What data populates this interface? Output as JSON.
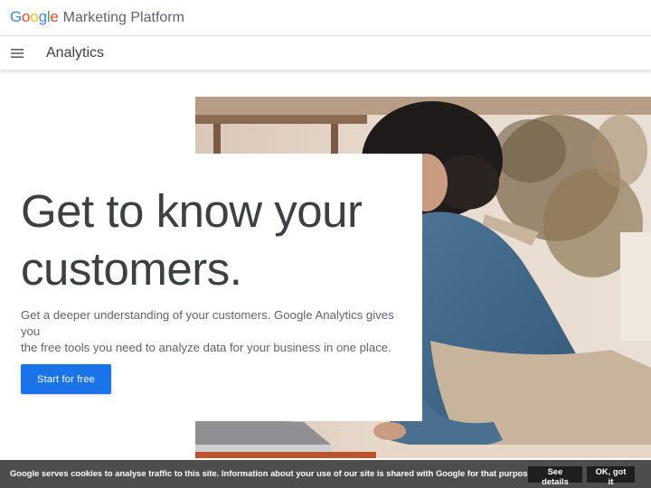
{
  "header": {
    "logo_letters": [
      "G",
      "o",
      "o",
      "g",
      "l",
      "e"
    ],
    "product": "Marketing Platform"
  },
  "nav": {
    "menu_icon": "hamburger-menu-icon",
    "title": "Analytics"
  },
  "hero": {
    "title_line1": "Get to know your",
    "title_line2": "customers.",
    "subtitle_line1": "Get a deeper understanding of your customers. Google Analytics gives you",
    "subtitle_line2": "the free tools you need to analyze data for your business in one place.",
    "cta_label": "Start for free",
    "cta_color": "#1a73e8"
  },
  "cookie_bar": {
    "text": "Google serves cookies to analyse traffic to this site. Information about your use of our site is shared with Google for that purpose.",
    "details_label": "See details",
    "ok_label": "OK, got it"
  },
  "colors": {
    "google_blue": "#4285F4",
    "google_red": "#EA4335",
    "google_yellow": "#FBBC05",
    "google_green": "#34A853"
  }
}
